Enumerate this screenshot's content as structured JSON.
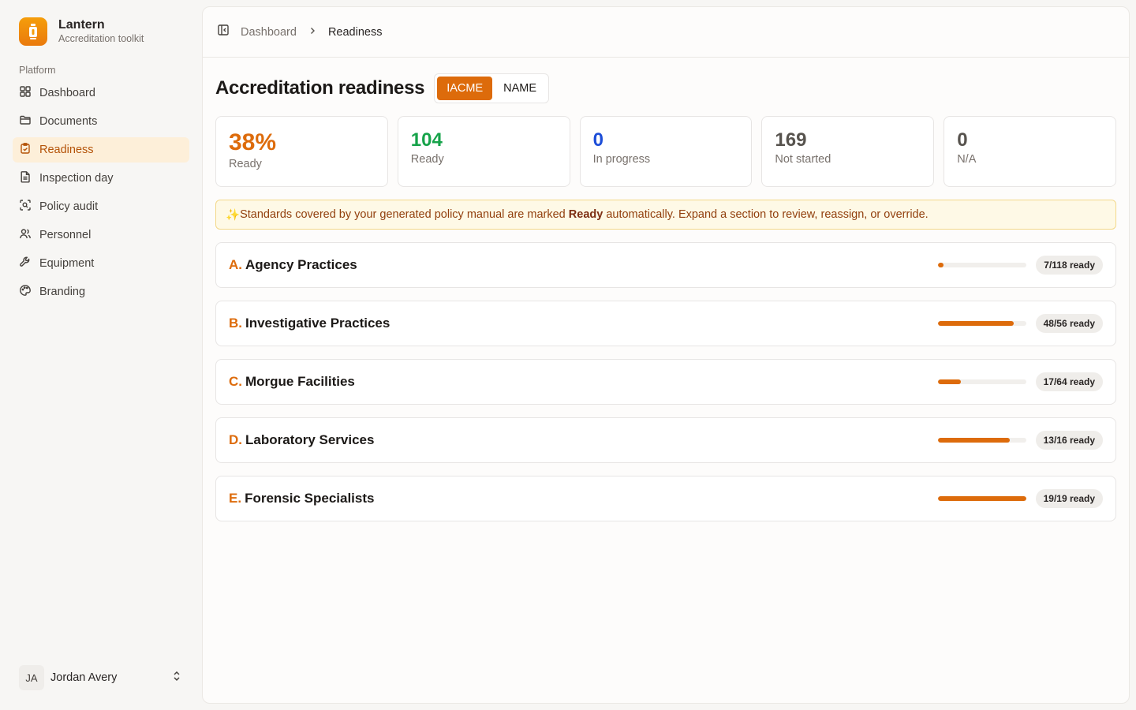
{
  "brand": {
    "name": "Lantern",
    "subtitle": "Accreditation toolkit"
  },
  "nav": {
    "group_label": "Platform",
    "items": [
      {
        "label": "Dashboard",
        "icon": "grid-icon"
      },
      {
        "label": "Documents",
        "icon": "folder-icon"
      },
      {
        "label": "Readiness",
        "icon": "clipboard-check-icon",
        "active": true
      },
      {
        "label": "Inspection day",
        "icon": "file-text-icon"
      },
      {
        "label": "Policy audit",
        "icon": "scan-search-icon"
      },
      {
        "label": "Personnel",
        "icon": "users-icon"
      },
      {
        "label": "Equipment",
        "icon": "wrench-icon"
      },
      {
        "label": "Branding",
        "icon": "palette-icon"
      }
    ]
  },
  "user": {
    "initials": "JA",
    "name": "Jordan Avery"
  },
  "breadcrumb": {
    "parent": "Dashboard",
    "current": "Readiness"
  },
  "page": {
    "title": "Accreditation readiness",
    "standards": [
      "IACME",
      "NAME"
    ],
    "selected_standard": "IACME"
  },
  "stats": [
    {
      "value": "38%",
      "label": "Ready",
      "color": "#dd6b0b"
    },
    {
      "value": "104",
      "label": "Ready",
      "color": "#16a34a"
    },
    {
      "value": "0",
      "label": "In progress",
      "color": "#1d4ed8"
    },
    {
      "value": "169",
      "label": "Not started",
      "color": "#57534e"
    },
    {
      "value": "0",
      "label": "N/A",
      "color": "#57534e"
    }
  ],
  "banner": {
    "icon": "✨",
    "before": "Standards covered by your generated policy manual are marked ",
    "bold": "Ready",
    "after": " automatically. Expand a section to review, reassign, or override."
  },
  "sections": [
    {
      "letter": "A.",
      "name": "Agency Practices",
      "ready": 7,
      "total": 118,
      "badge": "7/118 ready"
    },
    {
      "letter": "B.",
      "name": "Investigative Practices",
      "ready": 48,
      "total": 56,
      "badge": "48/56 ready"
    },
    {
      "letter": "C.",
      "name": "Morgue Facilities",
      "ready": 17,
      "total": 64,
      "badge": "17/64 ready"
    },
    {
      "letter": "D.",
      "name": "Laboratory Services",
      "ready": 13,
      "total": 16,
      "badge": "13/16 ready"
    },
    {
      "letter": "E.",
      "name": "Forensic Specialists",
      "ready": 19,
      "total": 19,
      "badge": "19/19 ready"
    }
  ],
  "colors": {
    "accent": "#dd6b0b",
    "active_nav_bg": "#fdefd9"
  }
}
